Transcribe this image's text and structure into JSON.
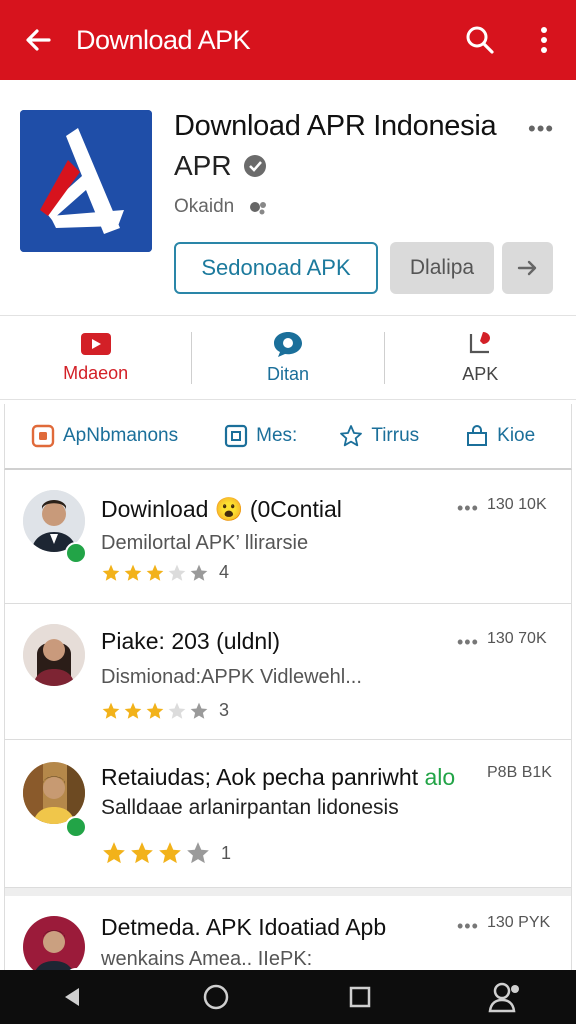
{
  "appbar": {
    "title": "Download APK",
    "background": "#d7131d",
    "icons": [
      "back-arrow-icon",
      "search-icon",
      "more-vert-icon"
    ]
  },
  "header": {
    "app_title": "Download APR Indonesia",
    "developer": "APR",
    "subtext": "Okaidn",
    "primary_button": "Sedonoad APK",
    "secondary_button": "Dlalipa",
    "more": "•••"
  },
  "quick_actions": [
    {
      "label": "Mdaeon",
      "icon": "youtube-icon",
      "color": "#d32027"
    },
    {
      "label": "Ditan",
      "icon": "chat-bubble-icon",
      "color": "#1b6f9a"
    },
    {
      "label": "APK",
      "icon": "install-icon",
      "color": "#444444"
    }
  ],
  "tabs": [
    {
      "label": "ApNbmanons",
      "icon": "grid-icon"
    },
    {
      "label": "Mes:",
      "icon": "square-icon"
    },
    {
      "label": "Tirrus",
      "icon": "star-outline-icon"
    },
    {
      "label": "Kioe",
      "icon": "shop-icon"
    }
  ],
  "list": [
    {
      "title": "Dowinload 😮 (0Contial",
      "subtitle": "Demilortal APK’ llirarsie",
      "stars": 3,
      "count": "4",
      "meta": "130 10K"
    },
    {
      "title": "Piake: 203 (uldnl)",
      "subtitle": "Dismionad:APPK Vidlewehl...",
      "stars": 3,
      "count": "3",
      "meta": "130 70K"
    },
    {
      "title": "Retaiudas; Aok pecha panriwht",
      "title_extra": "alo",
      "subtitle": "Salldaae arlanirpantan lidonesis",
      "stars": 3,
      "count": "1",
      "meta": "P8B B1K"
    },
    {
      "title": "Detmeda. APK Idoatiad Apb",
      "subtitle": "wenkains Amea.. IIePK:",
      "stars": 0,
      "count": "",
      "meta": "130 PYK"
    }
  ],
  "colors": {
    "accent": "#d7131d",
    "link": "#1b6f9a",
    "star": "#f2b21a",
    "star_empty": "#c9c9c9",
    "online": "#22a447"
  },
  "navbar": {
    "icons": [
      "nav-back-icon",
      "nav-home-icon",
      "nav-recents-icon",
      "nav-account-icon"
    ]
  }
}
